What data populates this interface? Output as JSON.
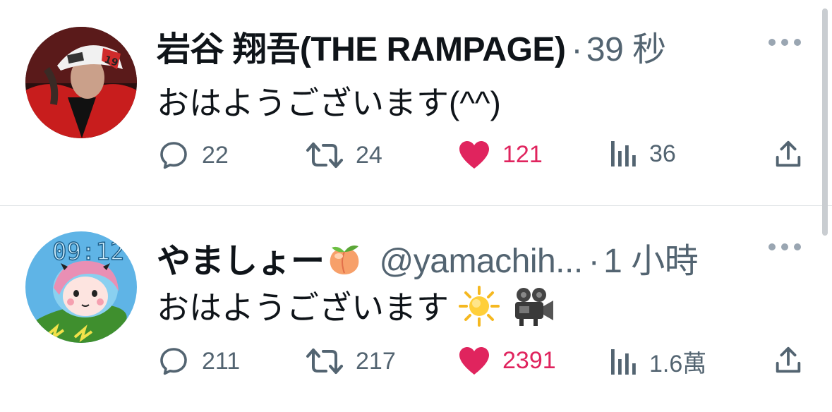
{
  "tweets": [
    {
      "display_name": "岩谷 翔吾(THE RAMPAGE)",
      "handle": "",
      "separator": "·",
      "time": "39 秒",
      "text": "おはようございます(^^)",
      "emojis": [],
      "replies": "22",
      "retweets": "24",
      "likes": "121",
      "views": "36",
      "liked": true
    },
    {
      "display_name": "やましょー",
      "name_emoji": "peach-icon",
      "handle": "@yamachih...",
      "separator": "·",
      "time": "1 小時",
      "text": "おはようございます",
      "emojis": [
        "sun-icon",
        "movie-camera-icon"
      ],
      "replies": "211",
      "retweets": "217",
      "likes": "2391",
      "views": "1.6萬",
      "liked": true
    }
  ],
  "avatar2_clock": "09:12",
  "colors": {
    "like": "#e0245e",
    "muted": "#536471",
    "divider": "#dfe3e6",
    "text": "#0f1419"
  }
}
